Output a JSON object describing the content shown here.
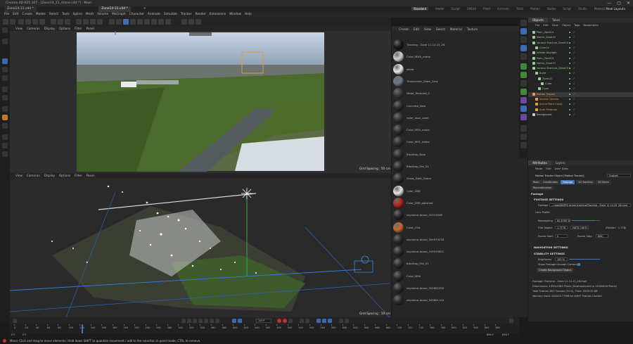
{
  "window": {
    "title": "Cinema 4D R25.107 - [Zone14_11_drone.c4d *] - Main",
    "minimize": "—",
    "maximize": "▢",
    "close": "✕"
  },
  "tabs": {
    "doc1": "Zone14-11.c4d *",
    "doc2": "Zone14-11.c4d *",
    "add": "+"
  },
  "layouts": [
    "Standard",
    "Model",
    "Sculpt",
    "UVEdit",
    "Paint",
    "Animate",
    "Track",
    "Motion",
    "Nodes",
    "Script",
    "Studio",
    "Material"
  ],
  "active_layout": "Standard",
  "new_layouts": "New Layouts",
  "menubar": [
    "File",
    "Edit",
    "Create",
    "Modes",
    "Select",
    "Tools",
    "Spline",
    "Mesh",
    "Volume",
    "MoGraph",
    "Character",
    "Animate",
    "Simulate",
    "Tracker",
    "Render",
    "Extensions",
    "Window",
    "Help"
  ],
  "viewport_top": {
    "menu": [
      "View",
      "Cameras",
      "Display",
      "Options",
      "Filter",
      "Panel"
    ],
    "label": "Perspective",
    "grid_spacing": "Grid Spacing : 50 cm"
  },
  "viewport_bottom": {
    "menu": [
      "View",
      "Cameras",
      "Display",
      "Options",
      "Filter",
      "Panel"
    ],
    "label": "Perspective",
    "grid_spacing": "Grid Spacing : 50 cm"
  },
  "materials": {
    "menu": [
      "Create",
      "Edit",
      "View",
      "Select",
      "Material",
      "Texture"
    ],
    "items": [
      {
        "name": "Tracking - Zone 11.14.15_26",
        "color": "#1a1a1a"
      },
      {
        "name": "Color_MIX0_metal",
        "color": "#cfcfcf"
      },
      {
        "name": "white",
        "color": "#e8e8e8"
      },
      {
        "name": "Translucent_Glass_Gray",
        "color": "#6d7886"
      },
      {
        "name": "Metal_Textured_1",
        "color": "#3a3a3a"
      },
      {
        "name": "Concrete_New",
        "color": "#2c2c2c"
      },
      {
        "name": "roller_door_steel",
        "color": "#333333"
      },
      {
        "name": "Color_M05_metal",
        "color": "#2d2d2d"
      },
      {
        "name": "Color_M01_metal",
        "color": "#2d2d2d"
      },
      {
        "name": "Blacktop_New",
        "color": "#2b2b2b"
      },
      {
        "name": "Blacktop_Old_01",
        "color": "#2a2a2a"
      },
      {
        "name": "Grass_Dark_Green",
        "color": "#2c2c2c"
      },
      {
        "name": "Color_D06",
        "color": "#e6e6e6"
      },
      {
        "name": "Color_D06_polished",
        "color": "#b8221f"
      },
      {
        "name": "skydrone-drone_31014508",
        "color": "#262626"
      },
      {
        "name": "Color_C04",
        "color": "#c9652a"
      },
      {
        "name": "skydrone-drone_304974218",
        "color": "#2a2a2a"
      },
      {
        "name": "skydrone-drone_315570621",
        "color": "#2a2a2a"
      },
      {
        "name": "Blacktop_Old_01",
        "color": "#2b2b2b"
      },
      {
        "name": "Color_M06",
        "color": "#2a2a2a"
      },
      {
        "name": "skydrone-drone_322682059",
        "color": "#2a2a2a"
      },
      {
        "name": "skydrone-drone_343601124",
        "color": "#2b2b2b"
      }
    ]
  },
  "objects": {
    "tabs": [
      "Objects",
      "Takes"
    ],
    "active_tab": "Objects",
    "menu": [
      "File",
      "Edit",
      "View",
      "Object",
      "Tags",
      "Bookmarks"
    ],
    "rows": [
      {
        "name": "Plain_Zone14",
        "color": "#9c9"
      },
      {
        "name": "Matrix_Zone14",
        "color": "#9c9"
      },
      {
        "name": "Voronoi Fracture_Zone14",
        "color": "#9c9"
      },
      {
        "name": "Cone14",
        "color": "#9c9"
      },
      {
        "name": "Infinite Daylight",
        "color": "#9c9"
      },
      {
        "name": "Plain_Zone13",
        "color": "#9c9"
      },
      {
        "name": "Matrix_Zone13",
        "color": "#9c9"
      },
      {
        "name": "Voronoi Fracture_Zone13",
        "color": "#9c9"
      },
      {
        "name": "Build",
        "color": "#9c9"
      },
      {
        "name": "Zone13",
        "color": "#9c9"
      },
      {
        "name": "Cube",
        "color": "#9c9"
      },
      {
        "name": "Cone",
        "color": "#9c9"
      },
      {
        "name": "Motion Tracker",
        "color": "#f0a040"
      },
      {
        "name": "Solved Camera",
        "color": "#f0a040"
      },
      {
        "name": "Scene Point Cloud",
        "color": "#f0a040"
      },
      {
        "name": "Auto Features",
        "color": "#f0a040"
      },
      {
        "name": "Background",
        "color": "#ccc"
      }
    ]
  },
  "attributes": {
    "tabs": [
      "Attributes",
      "Layers"
    ],
    "active_tab": "Attributes",
    "menu": [
      "Mode",
      "Edit",
      "User Data"
    ],
    "object_title": "Motion Tracker Object [Motion Tracker]",
    "preset": "Custom",
    "subtabs": [
      "Basic",
      "Coordinates",
      "Footage",
      "2D Tracking",
      "3D Solve",
      "Reconstruction"
    ],
    "active_subtab": "Footage",
    "section_footage": "Footage",
    "footage_settings": "FOOTAGE SETTINGS",
    "footage_label": "Footage",
    "footage_value": "...rage/SKYIPG drone tracking/Tracking - Zone 11.14.15_26.mp4",
    "lens_profile": "Lens Profile",
    "resampling_label": "Resampling",
    "resampling_value": "82.5355 %",
    "film_aspect_label": "Film Aspect",
    "film_aspect_value": "1.7778",
    "film_aspect_preset": "HDTV (16:9)",
    "render_label": "(Render : 1.778)",
    "frame_start_label": "Frame Start",
    "frame_start_value": "0",
    "frame_step_label": "Frame Step",
    "frame_step_value": "896",
    "navigation_settings": "NAVIGATION SETTINGS",
    "stability_settings": "STABILITY SETTINGS",
    "brightness_label": "Brightness",
    "brightness_value": "100 %",
    "show_footage_label": "Show Footage through Camera",
    "create_bg_button": "Create Background Object",
    "info": [
      "Footage: Tracking - Zone 11.14.15_26.mp4",
      "Dimensions: 1920x1080 Pixels (Downsampled to 1454x818 Pixels)",
      "Total Frames: 897 Frames (F.0.0), Time: 0500:35.88",
      "Memory Used: 263523.77MB for 8/897 Frames Cached"
    ]
  },
  "timeline": {
    "ticks": [
      "0",
      "10",
      "20",
      "30",
      "40",
      "50",
      "60",
      "70",
      "80",
      "90",
      "100",
      "110",
      "120",
      "130",
      "140",
      "150",
      "160",
      "170",
      "180",
      "190",
      "200",
      "210",
      "220",
      "230",
      "240",
      "250",
      "260",
      "270",
      "280",
      "290",
      "300",
      "310",
      "320",
      "330",
      "340",
      "350",
      "360",
      "370",
      "380",
      "390",
      "400",
      "410",
      "420",
      "430",
      "440",
      "450",
      "460",
      "470",
      "480",
      "490",
      "500",
      "510",
      "520",
      "530",
      "540",
      "550",
      "560",
      "570",
      "580",
      "590",
      "600",
      "610",
      "620",
      "630",
      "640",
      "650",
      "660",
      "670",
      "680",
      "690",
      "700",
      "710",
      "720",
      "730",
      "740",
      "750",
      "760",
      "770",
      "780",
      "790",
      "800",
      "810",
      "820",
      "830",
      "840",
      "850",
      "860",
      "870",
      "880",
      "890"
    ],
    "start_field": "0 F",
    "start_field2": "0 F",
    "current_frame": "110 F",
    "end_field": "896 F",
    "end_field2": "896 F"
  },
  "status": {
    "message": "Move: Click and drag to move elements. Hold down SHIFT to quantize movement / add to the selection in point mode, CTRL to remove."
  }
}
